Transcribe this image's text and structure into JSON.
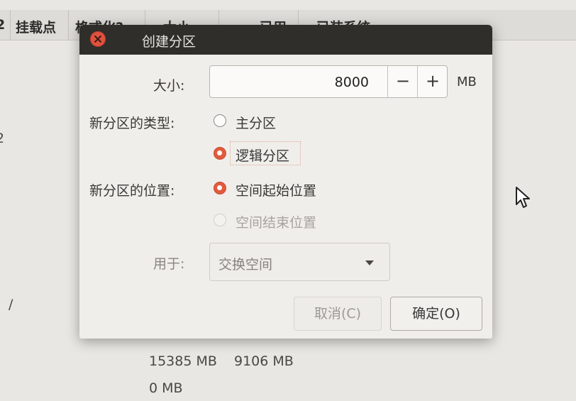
{
  "background": {
    "columns": [
      "挂载点",
      "格式化?",
      "大小",
      "已用",
      "已装系统"
    ],
    "left_fragment": "2",
    "slash": "/",
    "sizes": [
      "15385 MB",
      "0 MB"
    ],
    "used": [
      "9106 MB"
    ]
  },
  "dialog": {
    "title": "创建分区",
    "size_label": "大小:",
    "size_value": "8000",
    "decrement": "−",
    "increment": "+",
    "unit": "MB",
    "type_label": "新分区的类型:",
    "type_options": [
      "主分区",
      "逻辑分区"
    ],
    "type_selected": "逻辑分区",
    "location_label": "新分区的位置:",
    "location_options": [
      "空间起始位置",
      "空间结束位置"
    ],
    "location_selected": "空间起始位置",
    "use_label": "用于:",
    "use_value": "交换空间",
    "cancel_button": "取消(C)",
    "ok_button": "确定(O)"
  },
  "colors": {
    "accent": "#e25a3d",
    "titlebar": "#2f2e2b",
    "close": "#e0523f"
  },
  "icons": [
    "close-icon",
    "dropdown-arrow-icon",
    "mouse-pointer-icon"
  ]
}
